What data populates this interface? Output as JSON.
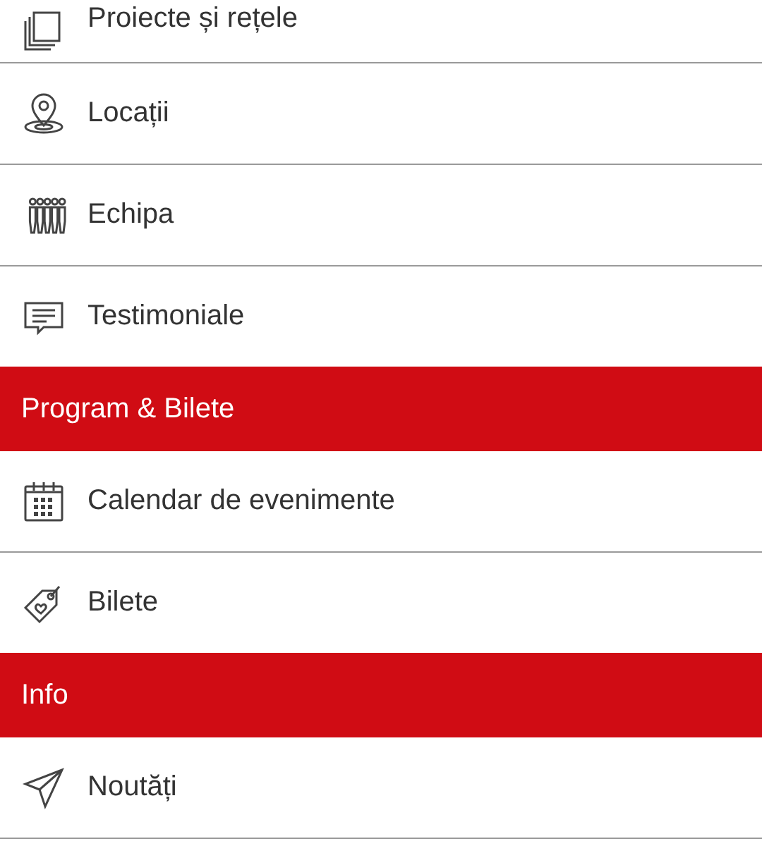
{
  "menu": [
    {
      "kind": "item",
      "label": "Proiecte și rețele"
    },
    {
      "kind": "item",
      "label": "Locații"
    },
    {
      "kind": "item",
      "label": "Echipa"
    },
    {
      "kind": "item",
      "label": "Testimoniale"
    },
    {
      "kind": "header",
      "label": "Program & Bilete"
    },
    {
      "kind": "item",
      "label": "Calendar de evenimente"
    },
    {
      "kind": "item",
      "label": "Bilete"
    },
    {
      "kind": "header",
      "label": "Info"
    },
    {
      "kind": "item",
      "label": "Noutăți"
    }
  ]
}
